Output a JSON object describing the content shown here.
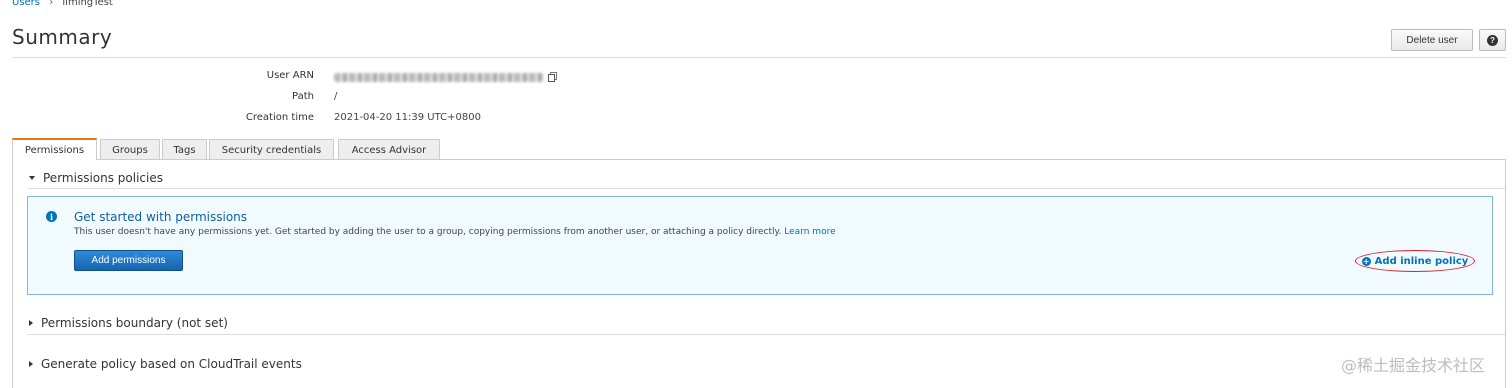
{
  "breadcrumb": {
    "root": "Users",
    "separator": "›",
    "current": "limingTest"
  },
  "page": {
    "title": "Summary"
  },
  "header_actions": {
    "delete_label": "Delete user",
    "help_label": "?"
  },
  "summary": {
    "rows": [
      {
        "label": "User ARN",
        "value": ""
      },
      {
        "label": "Path",
        "value": "/"
      },
      {
        "label": "Creation time",
        "value": "2021-04-20 11:39 UTC+0800"
      }
    ]
  },
  "tabs": [
    {
      "label": "Permissions",
      "active": true
    },
    {
      "label": "Groups",
      "active": false
    },
    {
      "label": "Tags",
      "active": false
    },
    {
      "label": "Security credentials",
      "active": false
    },
    {
      "label": "Access Advisor",
      "active": false
    }
  ],
  "sections": {
    "policies": {
      "title": "Permissions policies",
      "expanded": true
    },
    "boundary": {
      "title": "Permissions boundary (not set)",
      "expanded": false
    },
    "cloudtrail": {
      "title": "Generate policy based on CloudTrail events",
      "expanded": false
    }
  },
  "info_box": {
    "icon": "info-icon",
    "title": "Get started with permissions",
    "text": "This user doesn't have any permissions yet. Get started by adding the user to a group, copying permissions from another user, or attaching a policy directly.",
    "link": "Learn more",
    "primary_button": "Add permissions",
    "inline_policy_link": "Add inline policy"
  },
  "watermark": {
    "text": "@稀土掘金技术社区"
  },
  "colors": {
    "accent": "#0073bb",
    "tab_active_border": "#e47911",
    "info_bg": "#f1faff",
    "annotation_red": "#d9232d"
  }
}
